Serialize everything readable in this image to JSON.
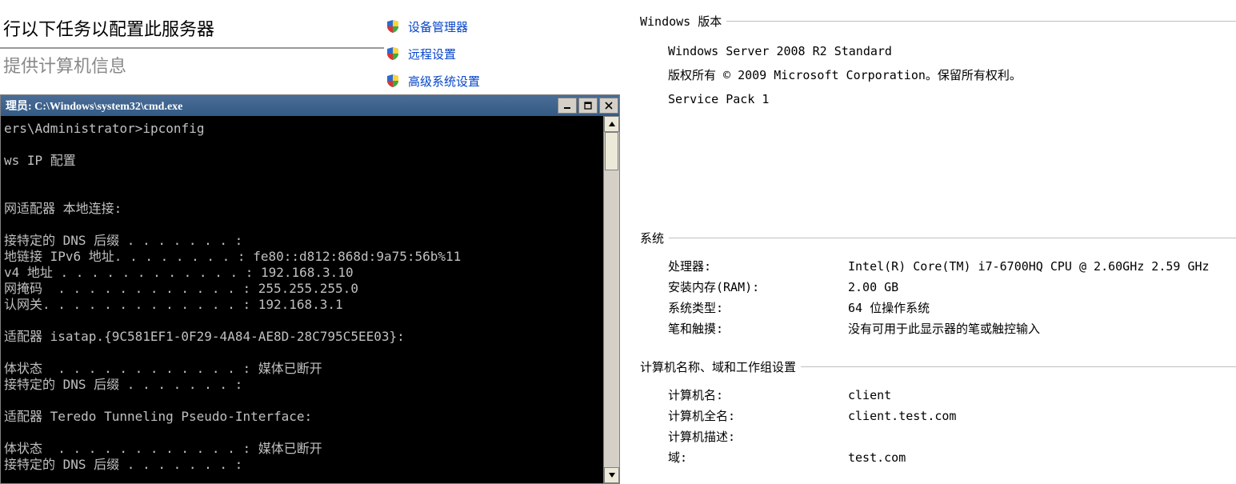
{
  "server_config": {
    "title": "行以下任务以配置此服务器",
    "subtitle": "提供计算机信息"
  },
  "links": {
    "device_manager": "设备管理器",
    "remote_settings": "远程设置",
    "advanced_settings": "高级系统设置"
  },
  "console": {
    "title": "理员: C:\\Windows\\system32\\cmd.exe",
    "content": "ers\\Administrator>ipconfig\n\nws IP 配置\n\n\n网适配器 本地连接:\n\n接特定的 DNS 后缀 . . . . . . . :\n地链接 IPv6 地址. . . . . . . . : fe80::d812:868d:9a75:56b%11\nv4 地址 . . . . . . . . . . . . : 192.168.3.10\n网掩码  . . . . . . . . . . . . : 255.255.255.0\n认网关. . . . . . . . . . . . . : 192.168.3.1\n\n适配器 isatap.{9C581EF1-0F29-4A84-AE8D-28C795C5EE03}:\n\n体状态  . . . . . . . . . . . . : 媒体已断开\n接特定的 DNS 后缀 . . . . . . . :\n\n适配器 Teredo Tunneling Pseudo-Interface:\n\n体状态  . . . . . . . . . . . . : 媒体已断开\n接特定的 DNS 后缀 . . . . . . . :"
  },
  "windows": {
    "header": "Windows 版本",
    "edition": "Windows Server 2008 R2 Standard",
    "copyright": "版权所有 © 2009 Microsoft Corporation。保留所有权利。",
    "service_pack": "Service Pack 1"
  },
  "system": {
    "header": "系统",
    "cpu_label": "处理器:",
    "cpu_value": "Intel(R) Core(TM) i7-6700HQ CPU @ 2.60GHz   2.59 GHz",
    "ram_label": "安装内存(RAM):",
    "ram_value": "2.00 GB",
    "type_label": "系统类型:",
    "type_value": "64 位操作系统",
    "pen_label": "笔和触摸:",
    "pen_value": "没有可用于此显示器的笔或触控输入"
  },
  "computer": {
    "header": "计算机名称、域和工作组设置",
    "name_label": "计算机名:",
    "name_value": "client",
    "fullname_label": "计算机全名:",
    "fullname_value": "client.test.com",
    "desc_label": "计算机描述:",
    "desc_value": "",
    "domain_label": "域:",
    "domain_value": "test.com"
  }
}
